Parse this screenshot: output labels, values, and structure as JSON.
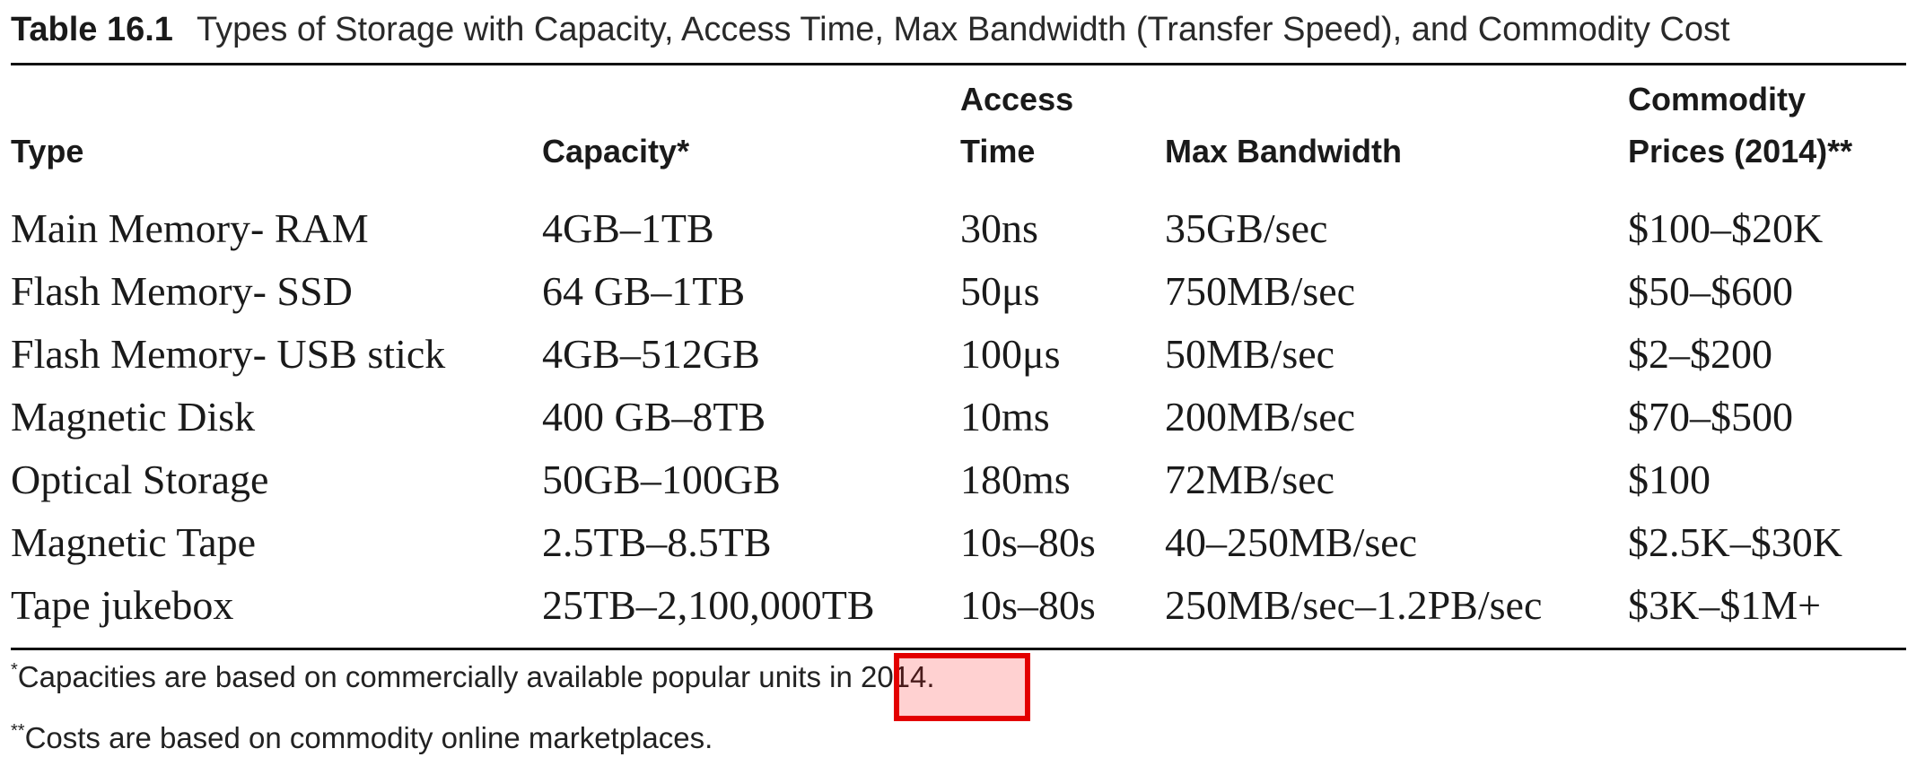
{
  "caption": {
    "label": "Table 16.1",
    "title": "Types of Storage with Capacity, Access Time, Max Bandwidth (Transfer Speed), and Commodity Cost"
  },
  "table": {
    "headers": [
      {
        "line1": "",
        "line2": "Type"
      },
      {
        "line1": "",
        "line2": "Capacity*"
      },
      {
        "line1": "Access",
        "line2": "Time"
      },
      {
        "line1": "",
        "line2": "Max Bandwidth"
      },
      {
        "line1": "Commodity",
        "line2": "Prices (2014)**"
      }
    ],
    "rows": [
      [
        "Main Memory- RAM",
        "4GB–1TB",
        "30ns",
        "35GB/sec",
        "$100–$20K"
      ],
      [
        "Flash Memory- SSD",
        "64 GB–1TB",
        "50μs",
        "750MB/sec",
        "$50–$600"
      ],
      [
        "Flash Memory- USB stick",
        "4GB–512GB",
        "100μs",
        "50MB/sec",
        "$2–$200"
      ],
      [
        "Magnetic Disk",
        "400 GB–8TB",
        "10ms",
        "200MB/sec",
        "$70–$500"
      ],
      [
        "Optical Storage",
        "50GB–100GB",
        "180ms",
        "72MB/sec",
        "$100"
      ],
      [
        "Magnetic Tape",
        "2.5TB–8.5TB",
        "10s–80s",
        "40–250MB/sec",
        "$2.5K–$30K"
      ],
      [
        "Tape jukebox",
        "25TB–2,100,000TB",
        "10s–80s",
        "250MB/sec–1.2PB/sec",
        "$3K–$1M+"
      ]
    ]
  },
  "footnotes": {
    "f1_mark": "*",
    "f1_text": "Capacities are based on commercially available popular units in 2014.",
    "f2_mark": "**",
    "f2_text": "Costs are based on commodity online marketplaces."
  },
  "highlight": {
    "target_text": "in 2014.",
    "color": "#e30000"
  }
}
